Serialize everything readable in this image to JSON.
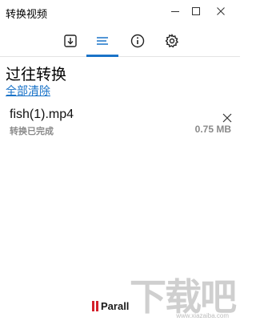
{
  "window": {
    "title": "转换视频",
    "controls": [
      "minimize-icon",
      "maximize-icon",
      "close-icon"
    ]
  },
  "toolbar": {
    "tabs": [
      {
        "icon": "download-icon",
        "active": false
      },
      {
        "icon": "list-icon",
        "active": true
      },
      {
        "icon": "info-icon",
        "active": false
      },
      {
        "icon": "gear-icon",
        "active": false
      }
    ],
    "accent": "#1a73c8"
  },
  "main": {
    "heading": "过往转换",
    "clear_all": "全部清除",
    "items": [
      {
        "name": "fish(1).mp4",
        "status": "转换已完成",
        "size": "0.75 MB"
      }
    ]
  },
  "footer": {
    "brand": "Parall",
    "brand_color": "#d4202a",
    "watermark": "下载吧",
    "watermark_url": "www.xiazaiba.com"
  }
}
